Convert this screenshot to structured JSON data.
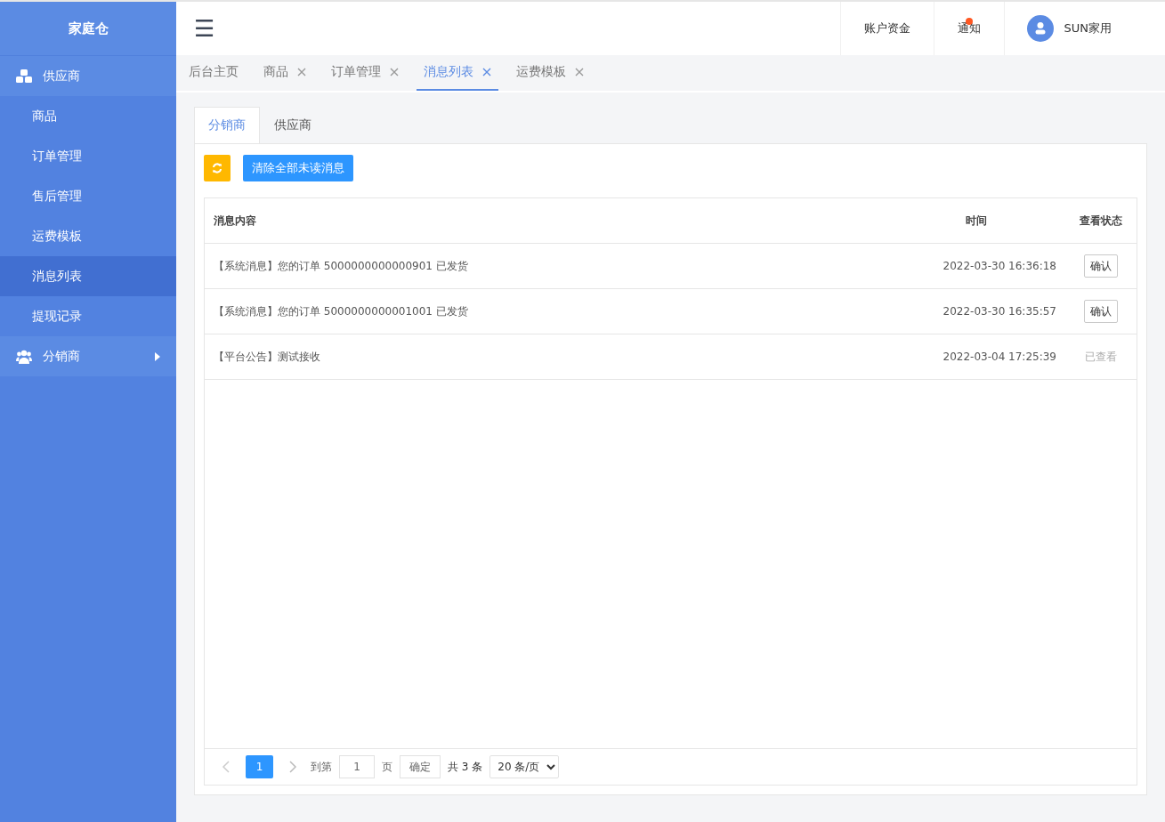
{
  "brand": "家庭仓",
  "sidebar": {
    "groups": [
      {
        "label": "供应商",
        "expanded": true,
        "children": [
          {
            "label": "商品",
            "selected": false
          },
          {
            "label": "订单管理",
            "selected": false
          },
          {
            "label": "售后管理",
            "selected": false
          },
          {
            "label": "运费模板",
            "selected": false
          },
          {
            "label": "消息列表",
            "selected": true
          },
          {
            "label": "提现记录",
            "selected": false
          }
        ]
      },
      {
        "label": "分销商",
        "expanded": false
      }
    ]
  },
  "header": {
    "menu_icon": "☰",
    "links": [
      {
        "label": "账户资金",
        "badge": false
      },
      {
        "label": "通知",
        "badge": true
      }
    ],
    "user": "SUN家用"
  },
  "page_tabs": [
    {
      "label": "后台主页",
      "closable": false,
      "selected": false
    },
    {
      "label": "商品",
      "closable": true,
      "selected": false
    },
    {
      "label": "订单管理",
      "closable": true,
      "selected": false
    },
    {
      "label": "消息列表",
      "closable": true,
      "selected": true
    },
    {
      "label": "运费模板",
      "closable": true,
      "selected": false
    }
  ],
  "sub_tabs": [
    {
      "label": "分销商",
      "selected": true
    },
    {
      "label": "供应商",
      "selected": false
    }
  ],
  "toolbar": {
    "clear_button": "清除全部未读消息"
  },
  "table": {
    "columns": [
      "消息内容",
      "时间",
      "查看状态"
    ],
    "rows": [
      {
        "content": "【系统消息】您的订单 5000000000000901 已发货",
        "time": "2022-03-30 16:36:18",
        "status": {
          "kind": "button",
          "label": "确认"
        }
      },
      {
        "content": "【系统消息】您的订单 5000000000001001 已发货",
        "time": "2022-03-30 16:35:57",
        "status": {
          "kind": "button",
          "label": "确认"
        }
      },
      {
        "content": "【平台公告】测试接收",
        "time": "2022-03-04 17:25:39",
        "status": {
          "kind": "text",
          "label": "已查看"
        }
      }
    ]
  },
  "pagination": {
    "current": "1",
    "goto_label": "到第",
    "goto_value": "1",
    "page_unit": "页",
    "confirm": "确定",
    "total": "共 3 条",
    "page_size": "20 条/页"
  }
}
